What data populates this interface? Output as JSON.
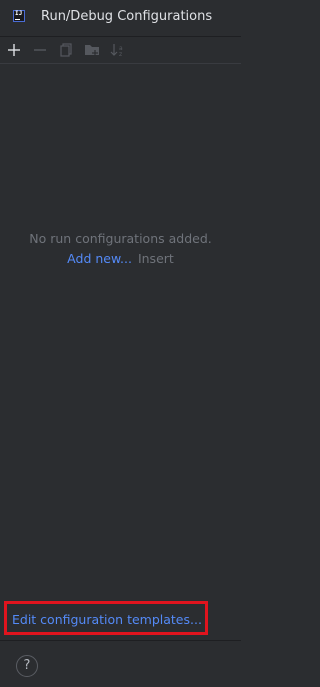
{
  "window": {
    "title": "Run/Debug Configurations",
    "app_icon_text": "IJ"
  },
  "toolbar": {
    "buttons": [
      {
        "icon": "plus-icon",
        "enabled": true
      },
      {
        "icon": "minus-icon",
        "enabled": false
      },
      {
        "icon": "copy-icon",
        "enabled": false
      },
      {
        "icon": "new-folder-icon",
        "enabled": false
      },
      {
        "icon": "sort-alphabetically-icon",
        "enabled": false
      }
    ]
  },
  "main": {
    "empty_text": "No run configurations added.",
    "add_new_label": "Add new...",
    "add_new_shortcut": "Insert"
  },
  "templates": {
    "link_label": "Edit configuration templates..."
  },
  "footer": {
    "help_label": "?"
  },
  "colors": {
    "background": "#2b2d30",
    "link": "#548af7",
    "muted_text": "#6f737a",
    "highlight": "#e0141e"
  }
}
